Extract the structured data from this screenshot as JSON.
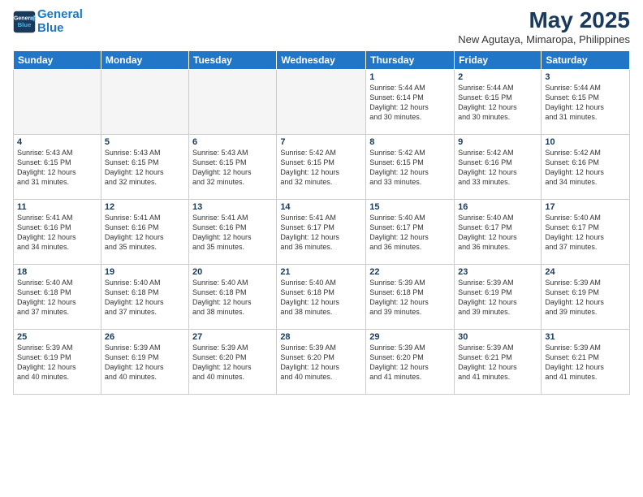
{
  "logo": {
    "line1": "General",
    "line2": "Blue"
  },
  "title": "May 2025",
  "subtitle": "New Agutaya, Mimaropa, Philippines",
  "weekdays": [
    "Sunday",
    "Monday",
    "Tuesday",
    "Wednesday",
    "Thursday",
    "Friday",
    "Saturday"
  ],
  "weeks": [
    [
      {
        "day": "",
        "info": ""
      },
      {
        "day": "",
        "info": ""
      },
      {
        "day": "",
        "info": ""
      },
      {
        "day": "",
        "info": ""
      },
      {
        "day": "1",
        "info": "Sunrise: 5:44 AM\nSunset: 6:14 PM\nDaylight: 12 hours\nand 30 minutes."
      },
      {
        "day": "2",
        "info": "Sunrise: 5:44 AM\nSunset: 6:15 PM\nDaylight: 12 hours\nand 30 minutes."
      },
      {
        "day": "3",
        "info": "Sunrise: 5:44 AM\nSunset: 6:15 PM\nDaylight: 12 hours\nand 31 minutes."
      }
    ],
    [
      {
        "day": "4",
        "info": "Sunrise: 5:43 AM\nSunset: 6:15 PM\nDaylight: 12 hours\nand 31 minutes."
      },
      {
        "day": "5",
        "info": "Sunrise: 5:43 AM\nSunset: 6:15 PM\nDaylight: 12 hours\nand 32 minutes."
      },
      {
        "day": "6",
        "info": "Sunrise: 5:43 AM\nSunset: 6:15 PM\nDaylight: 12 hours\nand 32 minutes."
      },
      {
        "day": "7",
        "info": "Sunrise: 5:42 AM\nSunset: 6:15 PM\nDaylight: 12 hours\nand 32 minutes."
      },
      {
        "day": "8",
        "info": "Sunrise: 5:42 AM\nSunset: 6:15 PM\nDaylight: 12 hours\nand 33 minutes."
      },
      {
        "day": "9",
        "info": "Sunrise: 5:42 AM\nSunset: 6:16 PM\nDaylight: 12 hours\nand 33 minutes."
      },
      {
        "day": "10",
        "info": "Sunrise: 5:42 AM\nSunset: 6:16 PM\nDaylight: 12 hours\nand 34 minutes."
      }
    ],
    [
      {
        "day": "11",
        "info": "Sunrise: 5:41 AM\nSunset: 6:16 PM\nDaylight: 12 hours\nand 34 minutes."
      },
      {
        "day": "12",
        "info": "Sunrise: 5:41 AM\nSunset: 6:16 PM\nDaylight: 12 hours\nand 35 minutes."
      },
      {
        "day": "13",
        "info": "Sunrise: 5:41 AM\nSunset: 6:16 PM\nDaylight: 12 hours\nand 35 minutes."
      },
      {
        "day": "14",
        "info": "Sunrise: 5:41 AM\nSunset: 6:17 PM\nDaylight: 12 hours\nand 36 minutes."
      },
      {
        "day": "15",
        "info": "Sunrise: 5:40 AM\nSunset: 6:17 PM\nDaylight: 12 hours\nand 36 minutes."
      },
      {
        "day": "16",
        "info": "Sunrise: 5:40 AM\nSunset: 6:17 PM\nDaylight: 12 hours\nand 36 minutes."
      },
      {
        "day": "17",
        "info": "Sunrise: 5:40 AM\nSunset: 6:17 PM\nDaylight: 12 hours\nand 37 minutes."
      }
    ],
    [
      {
        "day": "18",
        "info": "Sunrise: 5:40 AM\nSunset: 6:18 PM\nDaylight: 12 hours\nand 37 minutes."
      },
      {
        "day": "19",
        "info": "Sunrise: 5:40 AM\nSunset: 6:18 PM\nDaylight: 12 hours\nand 37 minutes."
      },
      {
        "day": "20",
        "info": "Sunrise: 5:40 AM\nSunset: 6:18 PM\nDaylight: 12 hours\nand 38 minutes."
      },
      {
        "day": "21",
        "info": "Sunrise: 5:40 AM\nSunset: 6:18 PM\nDaylight: 12 hours\nand 38 minutes."
      },
      {
        "day": "22",
        "info": "Sunrise: 5:39 AM\nSunset: 6:18 PM\nDaylight: 12 hours\nand 39 minutes."
      },
      {
        "day": "23",
        "info": "Sunrise: 5:39 AM\nSunset: 6:19 PM\nDaylight: 12 hours\nand 39 minutes."
      },
      {
        "day": "24",
        "info": "Sunrise: 5:39 AM\nSunset: 6:19 PM\nDaylight: 12 hours\nand 39 minutes."
      }
    ],
    [
      {
        "day": "25",
        "info": "Sunrise: 5:39 AM\nSunset: 6:19 PM\nDaylight: 12 hours\nand 40 minutes."
      },
      {
        "day": "26",
        "info": "Sunrise: 5:39 AM\nSunset: 6:19 PM\nDaylight: 12 hours\nand 40 minutes."
      },
      {
        "day": "27",
        "info": "Sunrise: 5:39 AM\nSunset: 6:20 PM\nDaylight: 12 hours\nand 40 minutes."
      },
      {
        "day": "28",
        "info": "Sunrise: 5:39 AM\nSunset: 6:20 PM\nDaylight: 12 hours\nand 40 minutes."
      },
      {
        "day": "29",
        "info": "Sunrise: 5:39 AM\nSunset: 6:20 PM\nDaylight: 12 hours\nand 41 minutes."
      },
      {
        "day": "30",
        "info": "Sunrise: 5:39 AM\nSunset: 6:21 PM\nDaylight: 12 hours\nand 41 minutes."
      },
      {
        "day": "31",
        "info": "Sunrise: 5:39 AM\nSunset: 6:21 PM\nDaylight: 12 hours\nand 41 minutes."
      }
    ]
  ]
}
